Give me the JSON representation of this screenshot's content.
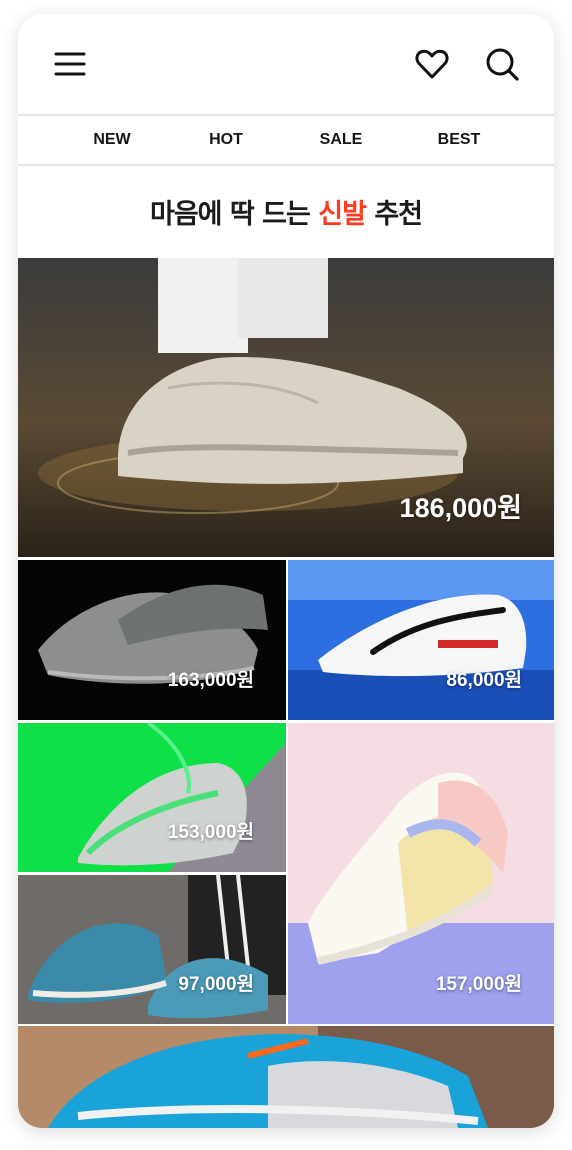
{
  "header": {
    "menu_icon": "hamburger-menu-icon",
    "wishlist_icon": "heart-icon",
    "search_icon": "search-icon"
  },
  "nav": {
    "items": [
      {
        "label": "NEW"
      },
      {
        "label": "HOT"
      },
      {
        "label": "SALE"
      },
      {
        "label": "BEST"
      }
    ]
  },
  "headline": {
    "before": "마음에 딱 드는 ",
    "accent": "신발",
    "after": " 추천",
    "accent_color": "#ff3b1f"
  },
  "products": [
    {
      "price": "186,000원"
    },
    {
      "price": "163,000원"
    },
    {
      "price": "86,000원"
    },
    {
      "price": "153,000원"
    },
    {
      "price": "97,000원"
    },
    {
      "price": "157,000원"
    },
    {
      "price": ""
    }
  ]
}
